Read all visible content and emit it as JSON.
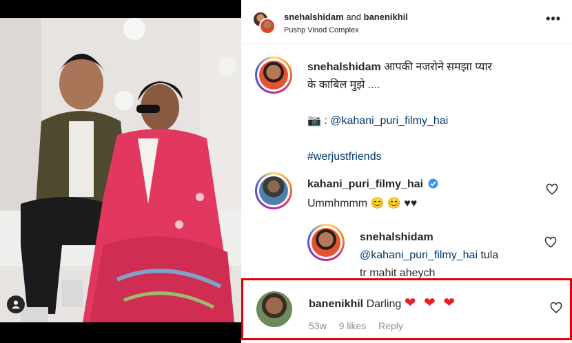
{
  "post": {
    "header": {
      "user1": "snehalshidam",
      "connector": " and ",
      "user2": "banenikhil",
      "location": "Pushp Vinod Complex",
      "more_icon": "more-horizontal-icon"
    },
    "caption": {
      "username": "snehalshidam",
      "line1": "आपकी नजरोने समझा प्यार",
      "line2": "के काबिल मुझे ....",
      "camera_emoji": "📷",
      "credit_prefix": " : ",
      "credit_handle": "@kahani_puri_filmy_hai",
      "hashtag": "#werjustfriends"
    },
    "comments": [
      {
        "username": "kahani_puri_filmy_hai",
        "verified": true,
        "text": "Ummhmmm",
        "emojis": "😊 😊 ♥♥"
      },
      {
        "username": "snehalshidam",
        "mention": "@kahani_puri_filmy_hai",
        "text_line1": " tula",
        "text_line2": "tr mahit aheych"
      },
      {
        "username": "banenikhil",
        "text": "Darling",
        "hearts": "❤ ❤ ❤",
        "time": "53w",
        "likes": "9 likes",
        "reply_label": "Reply"
      }
    ]
  },
  "colors": {
    "highlight_border": "#e00000",
    "link": "#00376b",
    "verified_blue": "#3897f0",
    "heart_red": "#ed1c24"
  }
}
